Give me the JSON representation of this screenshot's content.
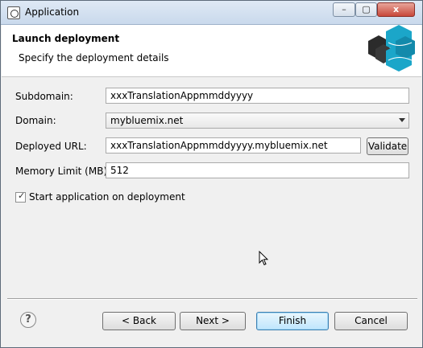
{
  "window": {
    "title": "Application",
    "min_glyph": "–",
    "max_glyph": "▢",
    "close_glyph": "x"
  },
  "banner": {
    "title": "Launch deployment",
    "subtitle": "Specify the deployment details"
  },
  "form": {
    "subdomain": {
      "label": "Subdomain:",
      "value": "xxxTranslationAppmmddyyyy"
    },
    "domain": {
      "label": "Domain:",
      "value": "mybluemix.net"
    },
    "deployed_url": {
      "label": "Deployed URL:",
      "value": "xxxTranslationAppmmddyyyy.mybluemix.net",
      "validate_label": "Validate"
    },
    "memory": {
      "label": "Memory Limit (MB):",
      "value": "512"
    },
    "start_on_deploy": {
      "label": "Start application on deployment",
      "checked": true,
      "check_glyph": "✓"
    }
  },
  "footer": {
    "help_glyph": "?",
    "back_label": "< Back",
    "next_label": "Next >",
    "finish_label": "Finish",
    "cancel_label": "Cancel"
  },
  "colors": {
    "logo_primary": "#1ba6c9",
    "logo_dark": "#2b2b2b"
  }
}
